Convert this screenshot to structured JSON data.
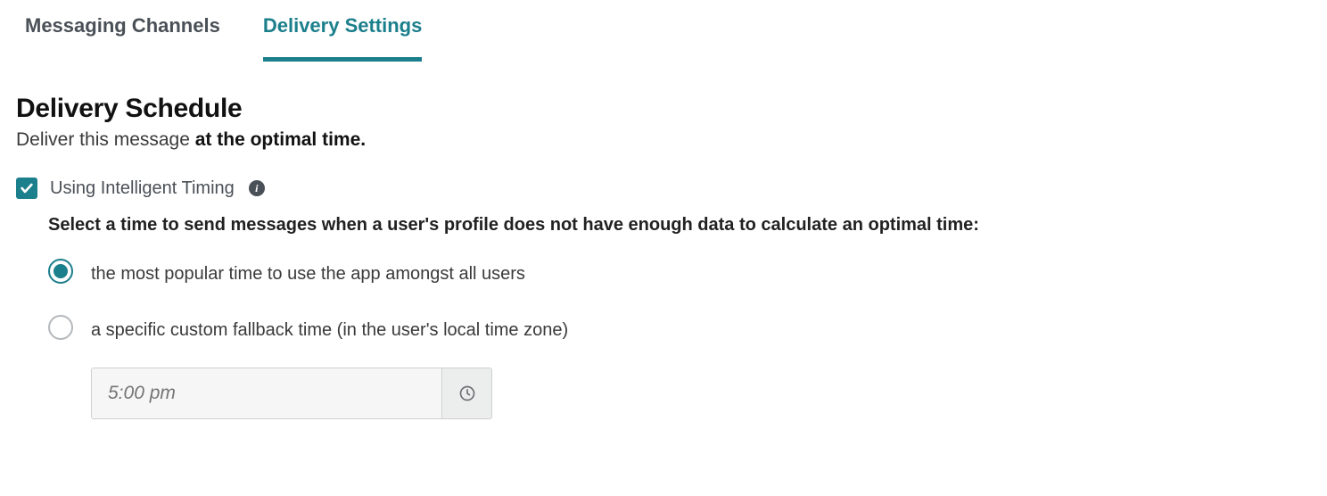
{
  "tabs": {
    "messaging": "Messaging Channels",
    "delivery": "Delivery Settings"
  },
  "heading": "Delivery Schedule",
  "subheading_prefix": "Deliver this message ",
  "subheading_bold": "at the optimal time.",
  "checkbox": {
    "label": "Using Intelligent Timing",
    "checked": true
  },
  "prompt": "Select a time to send messages when a user's profile does not have enough data to calculate an optimal time:",
  "options": {
    "popular": "the most popular time to use the app amongst all users",
    "custom": "a specific custom fallback time (in the user's local time zone)"
  },
  "selected_option": "popular",
  "time_input": {
    "placeholder": "5:00 pm"
  }
}
